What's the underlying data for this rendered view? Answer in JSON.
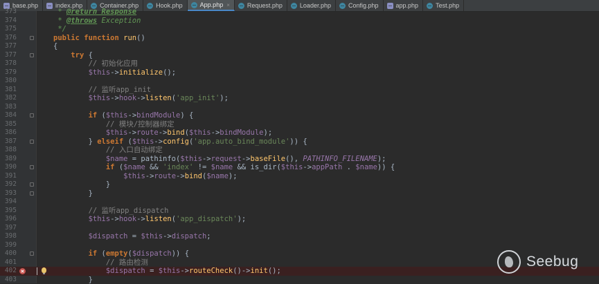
{
  "tabs": [
    {
      "name": "base.php",
      "icon": "php-file-icon",
      "active": false
    },
    {
      "name": "index.php",
      "icon": "php-file-icon",
      "active": false
    },
    {
      "name": "Container.php",
      "icon": "class-file-icon",
      "active": false
    },
    {
      "name": "Hook.php",
      "icon": "class-file-icon",
      "active": false
    },
    {
      "name": "App.php",
      "icon": "class-file-icon",
      "active": true
    },
    {
      "name": "Request.php",
      "icon": "class-file-icon",
      "active": false
    },
    {
      "name": "Loader.php",
      "icon": "class-file-icon",
      "active": false
    },
    {
      "name": "Config.php",
      "icon": "class-file-icon",
      "active": false
    },
    {
      "name": "app.php",
      "icon": "php-file-icon",
      "active": false
    },
    {
      "name": "Test.php",
      "icon": "class-file-icon",
      "active": false
    }
  ],
  "code_lines": [
    {
      "n": "373",
      "html": "<span class=\"d\"> * </span><span class=\"dt\">@return Response</span>"
    },
    {
      "n": "374",
      "html": "<span class=\"d\"> * </span><span class=\"dt\">@throws</span><span class=\"d\"> Exception</span>"
    },
    {
      "n": "375",
      "html": "<span class=\"d\"> */</span>"
    },
    {
      "n": "376",
      "html": "<span class=\"k\">public function </span><span class=\"f\">run</span>()",
      "fold": true
    },
    {
      "n": "377",
      "html": "{"
    },
    {
      "n": "377",
      "html": "    <span class=\"k\">try</span> {",
      "fold": true
    },
    {
      "n": "378",
      "html": "        <span class=\"c\">// 初始化应用</span>"
    },
    {
      "n": "379",
      "html": "        <span class=\"v\">$this</span>-><span class=\"f\">initialize</span>();"
    },
    {
      "n": "380",
      "html": ""
    },
    {
      "n": "381",
      "html": "        <span class=\"c\">// 监听app_init</span>"
    },
    {
      "n": "382",
      "html": "        <span class=\"v\">$this</span>-><span class=\"v\">hook</span>-><span class=\"f\">listen</span>(<span class=\"s\">'app_init'</span>);"
    },
    {
      "n": "383",
      "html": ""
    },
    {
      "n": "384",
      "html": "        <span class=\"k\">if</span> (<span class=\"v\">$this</span>-><span class=\"v\">bindModule</span>) {",
      "fold": true
    },
    {
      "n": "385",
      "html": "            <span class=\"c\">// 模块/控制器绑定</span>"
    },
    {
      "n": "386",
      "html": "            <span class=\"v\">$this</span>-><span class=\"v\">route</span>-><span class=\"f\">bind</span>(<span class=\"v\">$this</span>-><span class=\"v\">bindModule</span>);"
    },
    {
      "n": "387",
      "html": "        } <span class=\"k\">elseif</span> (<span class=\"v\">$this</span>-><span class=\"f\">config</span>(<span class=\"s\">'app.auto_bind_module'</span>)) {",
      "fold": true
    },
    {
      "n": "388",
      "html": "            <span class=\"c\">// 入口自动绑定</span>"
    },
    {
      "n": "389",
      "html": "            <span class=\"v\">$name</span> = pathinfo(<span class=\"v\">$this</span>-><span class=\"v\">request</span>-><span class=\"f\">baseFile</span>(), <span class=\"cn\">PATHINFO_FILENAME</span>);"
    },
    {
      "n": "390",
      "html": "            <span class=\"k\">if</span> (<span class=\"v\">$name</span> && <span class=\"s\">'index'</span> != <span class=\"v\">$name</span> && is_dir(<span class=\"v\">$this</span>-><span class=\"v\">appPath</span> . <span class=\"v\">$name</span>)) {",
      "fold": true
    },
    {
      "n": "391",
      "html": "                <span class=\"v\">$this</span>-><span class=\"v\">route</span>-><span class=\"f\">bind</span>(<span class=\"v\">$name</span>);"
    },
    {
      "n": "392",
      "html": "            }",
      "fold": true
    },
    {
      "n": "393",
      "html": "        }",
      "fold": true
    },
    {
      "n": "394",
      "html": ""
    },
    {
      "n": "395",
      "html": "        <span class=\"c\">// 监听app_dispatch</span>"
    },
    {
      "n": "396",
      "html": "        <span class=\"v\">$this</span>-><span class=\"v\">hook</span>-><span class=\"f\">listen</span>(<span class=\"s\">'app_dispatch'</span>);"
    },
    {
      "n": "397",
      "html": ""
    },
    {
      "n": "398",
      "html": "        <span class=\"v\">$dispatch</span> = <span class=\"v\">$this</span>-><span class=\"v\">dispatch</span>;"
    },
    {
      "n": "399",
      "html": ""
    },
    {
      "n": "400",
      "html": "        <span class=\"k\">if</span> (<span class=\"k\">empty</span>(<span class=\"v\">$dispatch</span>)) {",
      "fold": true
    },
    {
      "n": "401",
      "html": "            <span class=\"c\">// 路由检测</span>"
    },
    {
      "n": "402",
      "html": "            <span class=\"v\">$dispatch</span> = <span class=\"v\">$this</span>-><span class=\"f\">routeCheck</span>()-><span class=\"f\">init</span>();",
      "breakpoint": true
    },
    {
      "n": "403",
      "html": "        }"
    }
  ],
  "watermark": {
    "text": "Seebug"
  },
  "colors": {
    "background": "#2b2b2b",
    "keyword": "#cc7832",
    "variable": "#9876aa",
    "string": "#6a8759",
    "function": "#ffc66d",
    "comment": "#808080",
    "breakpoint": "#c75450"
  }
}
